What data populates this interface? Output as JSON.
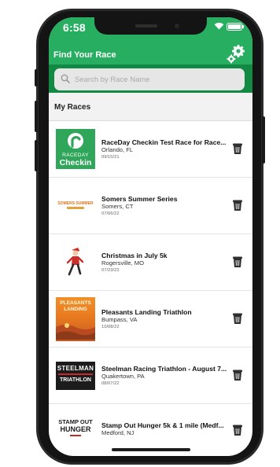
{
  "status_bar": {
    "time": "6:58"
  },
  "nav": {
    "title": "Find Your Race"
  },
  "search": {
    "placeholder": "Search by Race Name"
  },
  "section": {
    "title": "My Races"
  },
  "races": [
    {
      "name": "RaceDay Checkin Test Race for Race...",
      "location": "Orlando, FL",
      "date": "09/15/21",
      "logo": "raceday-checkin-logo",
      "logo_text_1": "RACEDAY",
      "logo_text_2": "Checkin"
    },
    {
      "name": "Somers Summer Series",
      "location": "Somers, CT",
      "date": "07/06/22",
      "logo": "somers-summer-series-logo",
      "logo_text_1": "SOMERS SUMMER"
    },
    {
      "name": "Christmas in July 5k",
      "location": "Rogersville, MO",
      "date": "07/23/22",
      "logo": "christmas-runner-logo"
    },
    {
      "name": "Pleasants Landing Triathlon",
      "location": "Bumpass, VA",
      "date": "10/08/22",
      "logo": "pleasants-landing-logo",
      "logo_text_1": "PLEASANTS",
      "logo_text_2": "LANDING"
    },
    {
      "name": "Steelman Racing Triathlon - August 7...",
      "location": "Quakertown, PA",
      "date": "08/07/22",
      "logo": "steelman-triathlon-logo",
      "logo_text_1": "STEELMAN",
      "logo_text_2": "TRIATHLON"
    },
    {
      "name": "Stamp Out Hunger 5k & 1 mile (Medf...",
      "location": "Medford, NJ",
      "date": "",
      "logo": "stamp-out-hunger-logo",
      "logo_text_1": "STAMP OUT",
      "logo_text_2": "HUNGER"
    }
  ],
  "colors": {
    "primary": "#27ae60",
    "primary_dark": "#128a43"
  }
}
